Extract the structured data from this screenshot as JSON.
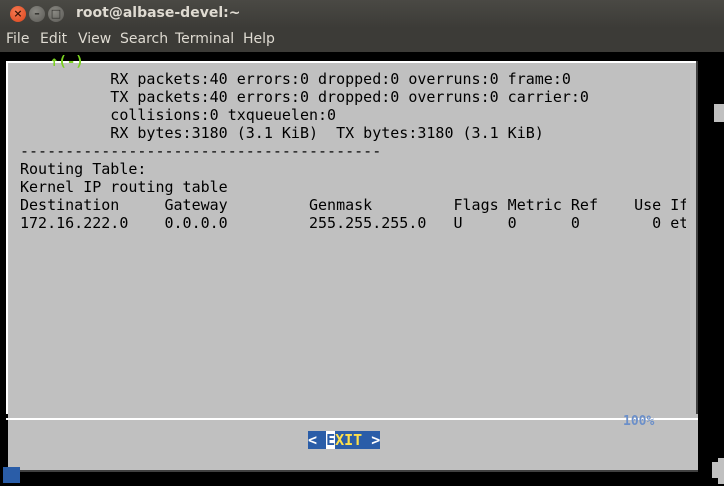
{
  "window": {
    "title": "root@albase-devel:~",
    "close_glyph": "×",
    "min_glyph": "–",
    "max_glyph": "□"
  },
  "menubar": {
    "items": [
      "File",
      "Edit",
      "View",
      "Search",
      "Terminal",
      "Help"
    ]
  },
  "dialog": {
    "scroll_indicator": "↑(-)",
    "lines": [
      "          RX packets:40 errors:0 dropped:0 overruns:0 frame:0",
      "          TX packets:40 errors:0 dropped:0 overruns:0 carrier:0",
      "          collisions:0 txqueuelen:0",
      "          RX bytes:3180 (3.1 KiB)  TX bytes:3180 (3.1 KiB)",
      "----------------------------------------",
      "Routing Table:",
      "Kernel IP routing table",
      "Destination     Gateway         Genmask         Flags Metric Ref    Use If",
      "172.16.222.0    0.0.0.0         255.255.255.0   U     0      0        0 et"
    ],
    "percent": "100%",
    "exit_button": {
      "left_bracket": "< ",
      "hotkey": "E",
      "rest": "XIT",
      "right_bracket": " >"
    }
  },
  "colors": {
    "dialog_bg": "#c0c0c0",
    "button_bg": "#2a5da8",
    "button_text": "#ffe14a",
    "percent": "#6b8fc9",
    "scroll_indicator": "#7bd321"
  }
}
